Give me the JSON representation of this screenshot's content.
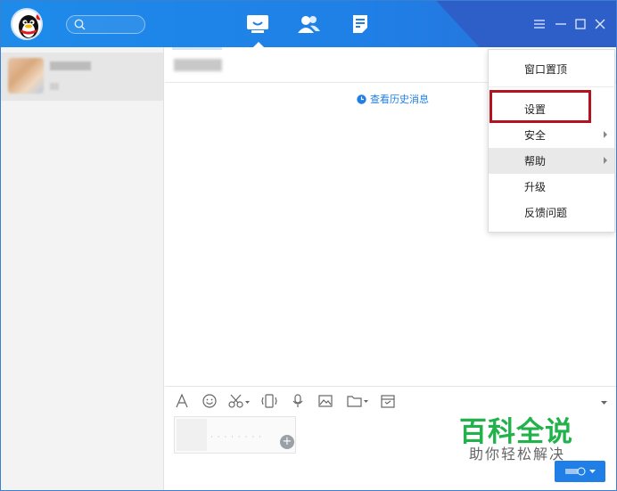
{
  "search": {
    "placeholder": ""
  },
  "nav": {
    "tabs": [
      {
        "icon": "message-icon",
        "active": true
      },
      {
        "icon": "contacts-icon",
        "active": false
      },
      {
        "icon": "document-icon",
        "active": false
      }
    ]
  },
  "window_controls": [
    "menu-icon",
    "minimize-icon",
    "maximize-icon",
    "close-icon"
  ],
  "chat": {
    "history_link": "查看历史消息"
  },
  "menu": {
    "items": [
      {
        "label": "窗口置顶",
        "submenu": false
      },
      {
        "label": "设置",
        "submenu": false,
        "highlighted": true
      },
      {
        "label": "安全",
        "submenu": true
      },
      {
        "label": "帮助",
        "submenu": true,
        "hover": true
      },
      {
        "label": "升级",
        "submenu": false
      },
      {
        "label": "反馈问题",
        "submenu": false
      }
    ]
  },
  "toolbar": {
    "icons": [
      "font-icon",
      "emoji-icon",
      "scissors-icon",
      "shake-icon",
      "voice-icon",
      "image-icon",
      "folder-icon",
      "calendar-icon"
    ]
  },
  "watermark": {
    "title": "百科全说",
    "subtitle": "助你轻松解决"
  },
  "colors": {
    "brand_blue": "#1f7fe6",
    "title_dark": "#2e5fc9",
    "highlight_red": "#b3121f",
    "watermark_green": "#21b24b"
  }
}
